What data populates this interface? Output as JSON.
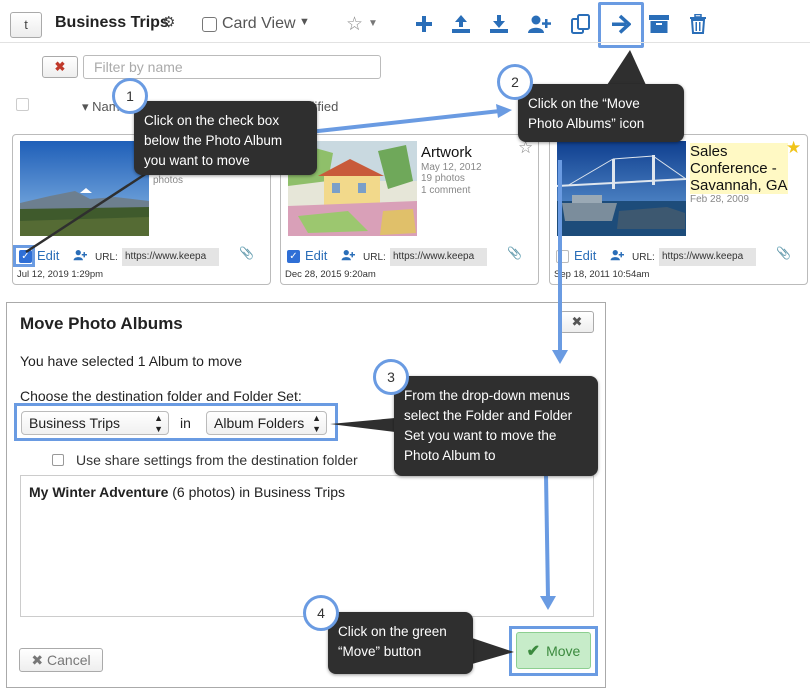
{
  "toolbar": {
    "back_label": "t",
    "folder_title": "Business Trips",
    "card_view_label": "Card View"
  },
  "filter": {
    "placeholder": "Filter by name"
  },
  "list_header": {
    "name_label": "Nam",
    "modified_label": "odified"
  },
  "albums": [
    {
      "title": "",
      "meta": [
        "photos"
      ],
      "edit_label": "Edit",
      "url_label": "URL:",
      "url_value": "https://www.keepa",
      "date": "Jul 12, 2019 1:29pm",
      "checked": true
    },
    {
      "title": "Artwork",
      "meta": [
        "May 12, 2012",
        "19 photos",
        "1 comment"
      ],
      "edit_label": "Edit",
      "url_label": "URL:",
      "url_value": "https://www.keepa",
      "date": "Dec 28, 2015 9:20am",
      "checked": true
    },
    {
      "title": "Sales Conference - Savannah, GA",
      "meta": [
        "Feb 28, 2009"
      ],
      "edit_label": "Edit",
      "url_label": "URL:",
      "url_value": "https://www.keepa",
      "date": "Sep 18, 2011 10:54am",
      "checked": false
    }
  ],
  "dialog": {
    "title": "Move Photo Albums",
    "selected_text": "You have selected 1 Album to move",
    "choose_text": "Choose the destination folder and Folder Set:",
    "folder_select": "Business Trips",
    "in_word": "in",
    "folderset_select": "Album Folders",
    "share_label": "Use share settings from the destination folder",
    "album_name": "My Winter Adventure",
    "album_rest": " (6 photos) in Business Trips",
    "cancel_label": "Cancel",
    "move_label": "Move"
  },
  "callouts": [
    {
      "num": "1",
      "text": "Click on the check box below the Photo Album you want to move"
    },
    {
      "num": "2",
      "text": "Click on the “Move Photo Albums” icon"
    },
    {
      "num": "3",
      "text": "From the drop-down menus select the Folder and Folder Set you want to move the Photo Album to"
    },
    {
      "num": "4",
      "text": "Click on the green “Move” button"
    }
  ],
  "colors": {
    "accent": "#2a6eb8",
    "highlight": "#6a9be2",
    "callout_bg": "#2f2f2f",
    "move_button_bg": "#c7ecc9",
    "favorite_star": "#f0c419",
    "title_highlight": "#fff9c4"
  }
}
